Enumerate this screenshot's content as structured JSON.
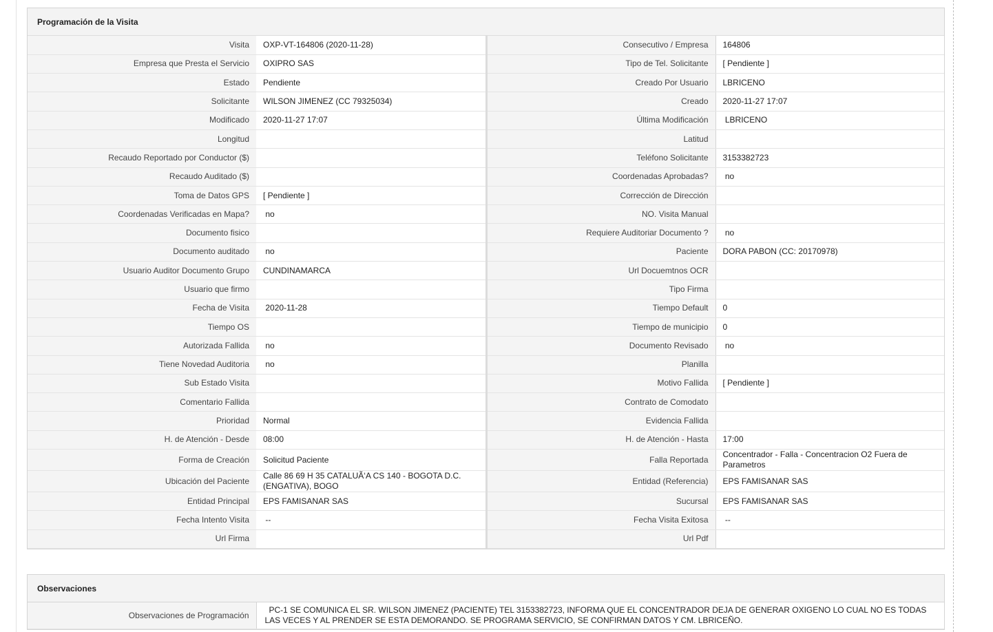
{
  "section": {
    "title": "Programación de la Visita"
  },
  "rows": [
    {
      "l1": "Visita",
      "v1": "OXP-VT-164806 (2020-11-28)",
      "l2": "Consecutivo / Empresa",
      "v2": "164806"
    },
    {
      "l1": "Empresa que Presta el Servicio",
      "v1": "OXIPRO SAS",
      "l2": "Tipo de Tel. Solicitante",
      "v2": "[ Pendiente ]"
    },
    {
      "l1": "Estado",
      "v1": "Pendiente",
      "l2": "Creado Por Usuario",
      "v2": "LBRICENO"
    },
    {
      "l1": "Solicitante",
      "v1": "WILSON JIMENEZ (CC 79325034)",
      "l2": "Creado",
      "v2": "2020-11-27 17:07"
    },
    {
      "l1": "Modificado",
      "v1": "2020-11-27 17:07",
      "l2": "Última Modificación",
      "v2": " LBRICENO"
    },
    {
      "l1": "Longitud",
      "v1": "",
      "l2": "Latitud",
      "v2": ""
    },
    {
      "l1": "Recaudo Reportado por Conductor ($)",
      "v1": "",
      "l2": "Teléfono Solicitante",
      "v2": "3153382723"
    },
    {
      "l1": "Recaudo Auditado ($)",
      "v1": "",
      "l2": "Coordenadas Aprobadas?",
      "v2": " no"
    },
    {
      "l1": "Toma de Datos GPS",
      "v1": "[ Pendiente ]",
      "l2": "Corrección de Dirección",
      "v2": ""
    },
    {
      "l1": "Coordenadas Verificadas en Mapa?",
      "v1": " no",
      "l2": "NO. Visita Manual",
      "v2": ""
    },
    {
      "l1": "Documento fisico",
      "v1": "",
      "l2": "Requiere Auditoriar Documento ?",
      "v2": " no"
    },
    {
      "l1": "Documento auditado",
      "v1": " no",
      "l2": "Paciente",
      "v2": "DORA PABON (CC: 20170978)"
    },
    {
      "l1": "Usuario Auditor Documento Grupo",
      "v1": "CUNDINAMARCA",
      "l2": "Url Docuemtnos OCR",
      "v2": ""
    },
    {
      "l1": "Usuario que firmo",
      "v1": "",
      "l2": "Tipo Firma",
      "v2": ""
    },
    {
      "l1": "Fecha de Visita",
      "v1": " 2020-11-28",
      "l2": "Tiempo Default",
      "v2": "0"
    },
    {
      "l1": "Tiempo OS",
      "v1": "",
      "l2": "Tiempo de municipio",
      "v2": "0"
    },
    {
      "l1": "Autorizada Fallida",
      "v1": " no",
      "l2": "Documento Revisado",
      "v2": " no"
    },
    {
      "l1": "Tiene Novedad Auditoria",
      "v1": " no",
      "l2": "Planilla",
      "v2": ""
    },
    {
      "l1": "Sub Estado Visita",
      "v1": "",
      "l2": "Motivo Fallida",
      "v2": "[ Pendiente ]"
    },
    {
      "l1": "Comentario Fallida",
      "v1": "",
      "l2": "Contrato de Comodato",
      "v2": ""
    },
    {
      "l1": "Prioridad",
      "v1": "Normal",
      "l2": "Evidencia Fallida",
      "v2": ""
    },
    {
      "l1": "H. de Atención - Desde",
      "v1": "08:00",
      "l2": "H. de Atención - Hasta",
      "v2": "17:00"
    },
    {
      "l1": "Forma de Creación",
      "v1": "Solicitud Paciente",
      "l2": "Falla Reportada",
      "v2": "Concentrador - Falla - Concentracion O2 Fuera de Parametros"
    },
    {
      "l1": "Ubicación del Paciente",
      "v1": "Calle 86 69 H 35 CATALUÃ‘A CS 140 - BOGOTA D.C. (ENGATIVA), BOGO",
      "l2": "Entidad (Referencia)",
      "v2": "EPS FAMISANAR SAS"
    },
    {
      "l1": "Entidad Principal",
      "v1": "EPS FAMISANAR SAS",
      "l2": "Sucursal",
      "v2": "EPS FAMISANAR SAS"
    },
    {
      "l1": "Fecha Intento Visita",
      "v1": " --",
      "l2": "Fecha Visita Exitosa",
      "v2": " --"
    },
    {
      "l1": "Url Firma",
      "v1": "",
      "l2": "Url Pdf",
      "v2": ""
    }
  ],
  "observaciones": {
    "title": "Observaciones",
    "label": "Observaciones de Programación",
    "value": "PC-1 SE COMUNICA EL SR. WILSON JIMENEZ (PACIENTE) TEL 3153382723, INFORMA QUE EL CONCENTRADOR DEJA DE GENERAR OXIGENO LO CUAL NO ES TODAS LAS VECES Y AL PRENDER SE ESTA DEMORANDO. SE PROGRAMA SERVICIO, SE CONFIRMAN DATOS Y CM. LBRICEÑO."
  }
}
